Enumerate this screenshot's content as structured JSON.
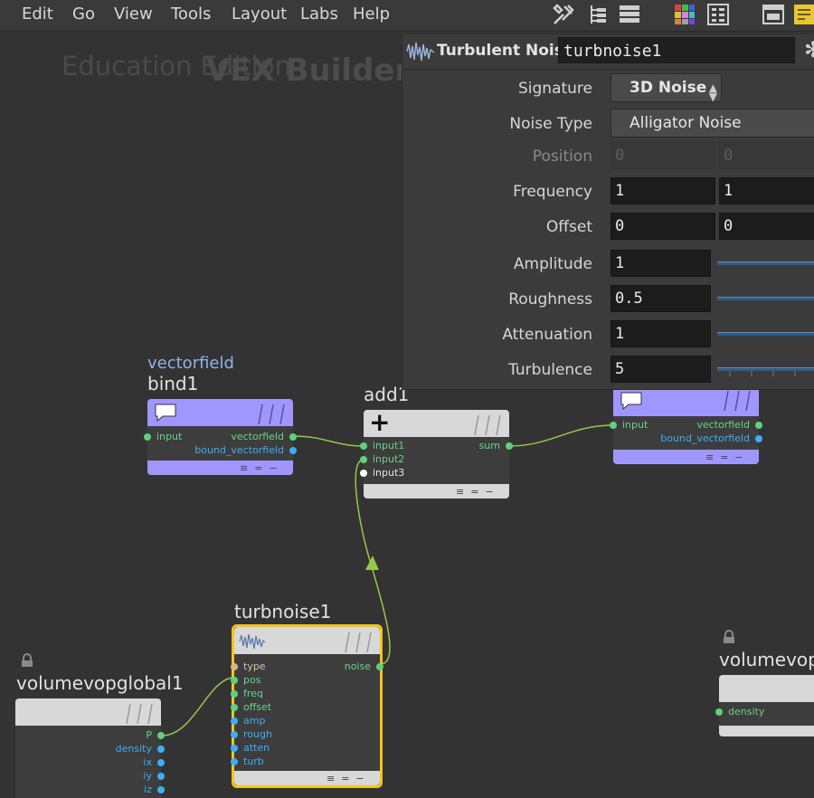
{
  "menu": [
    "Edit",
    "Go",
    "View",
    "Tools",
    "Layout",
    "Labs",
    "Help"
  ],
  "toolbar_icons": [
    "tools-icon",
    "tree-view-icon",
    "list-view-icon",
    "color-palette-icon",
    "grid-layout-icon",
    "window-icon",
    "sticky-note-icon"
  ],
  "network": {
    "watermark": "Education Edition",
    "context_title": "VEX Builder"
  },
  "params": {
    "node_type": "Turbulent Noise",
    "node_name": "turbnoise1",
    "gear_icon": "gear-icon",
    "rows": [
      {
        "label": "Signature",
        "value": "3D Noise"
      },
      {
        "label": "Noise Type",
        "value": "Alligator Noise"
      },
      {
        "label": "Position",
        "values": [
          "0",
          "0"
        ]
      },
      {
        "label": "Frequency",
        "values": [
          "1",
          "1"
        ]
      },
      {
        "label": "Offset",
        "values": [
          "0",
          "0"
        ]
      },
      {
        "label": "Amplitude",
        "value": "1"
      },
      {
        "label": "Roughness",
        "value": "0.5"
      },
      {
        "label": "Attenuation",
        "value": "1"
      },
      {
        "label": "Turbulence",
        "value": "5"
      }
    ]
  },
  "nodes": {
    "bind1": {
      "context": "vectorfield",
      "name": "bind1",
      "in": [
        "input"
      ],
      "out": [
        "vectorfield",
        "bound_vectorfield"
      ]
    },
    "add1": {
      "name": "add1",
      "in": [
        "input1",
        "input2",
        "input3"
      ],
      "out": [
        "sum"
      ]
    },
    "bind_out": {
      "in": [
        "input"
      ],
      "out": [
        "vectorfield",
        "bound_vectorfield"
      ]
    },
    "turbnoise1": {
      "name": "turbnoise1",
      "in": [
        "type",
        "pos",
        "freq",
        "offset",
        "amp",
        "rough",
        "atten",
        "turb"
      ],
      "out": [
        "noise"
      ]
    },
    "volumevopglobal1": {
      "name": "volumevopglobal1",
      "out": [
        "P",
        "density",
        "ix",
        "iy",
        "iz"
      ]
    },
    "volumevop_out": {
      "name": "volumevop",
      "in": [
        "density"
      ]
    }
  },
  "colors": {
    "bind_node": "#9f97ff",
    "wire": "#95c84a",
    "selected": "#f3c61a",
    "pin_green": "#5fd17d",
    "pin_blue": "#3daef5"
  }
}
